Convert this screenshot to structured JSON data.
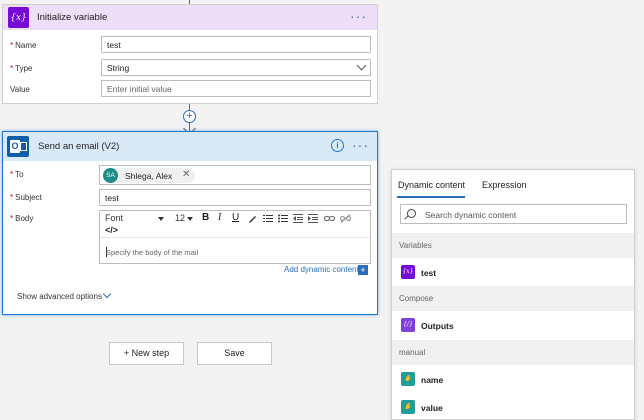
{
  "init_variable": {
    "title": "Initialize variable",
    "icon": "variable-icon",
    "name_label": "Name",
    "name_value": "test",
    "type_label": "Type",
    "type_value": "String",
    "value_label": "Value",
    "value_placeholder": "Enter initial value",
    "menu": "···"
  },
  "send_email": {
    "title": "Send an email (V2)",
    "icon": "outlook-icon",
    "menu": "···",
    "to_label": "To",
    "to_recipient": {
      "initials": "SA",
      "name": "Shlega, Alex"
    },
    "subject_label": "Subject",
    "subject_value": "test",
    "body_label": "Body",
    "toolbar": {
      "font": "Font",
      "size": "12",
      "bold": "B",
      "italic": "I",
      "underline": "U",
      "code": "</>"
    },
    "body_placeholder": "Specify the body of the mail",
    "add_dynamic": "Add dynamic content",
    "show_advanced": "Show advanced options"
  },
  "buttons": {
    "new_step": "+ New step",
    "save": "Save"
  },
  "dynamic_panel": {
    "tabs": [
      "Dynamic content",
      "Expression"
    ],
    "active_tab": "Dynamic content",
    "search_placeholder": "Search dynamic content",
    "sections": [
      {
        "title": "Variables",
        "items": [
          {
            "label": "test",
            "icon": "variable-icon"
          }
        ]
      },
      {
        "title": "Compose",
        "items": [
          {
            "label": "Outputs",
            "icon": "compose-icon"
          }
        ]
      },
      {
        "title": "manual",
        "items": [
          {
            "label": "name",
            "icon": "manual-trigger-icon"
          },
          {
            "label": "value",
            "icon": "manual-trigger-icon"
          }
        ]
      }
    ]
  },
  "colors": {
    "variable_header": "#eedff9",
    "variable_icon": "#770bd6",
    "email_header": "#d9e9f8",
    "accent": "#2a6ebb",
    "outlook": "#0f5ea8",
    "manual_icon": "#1e9e9a",
    "compose_icon": "#7f3fdc"
  }
}
